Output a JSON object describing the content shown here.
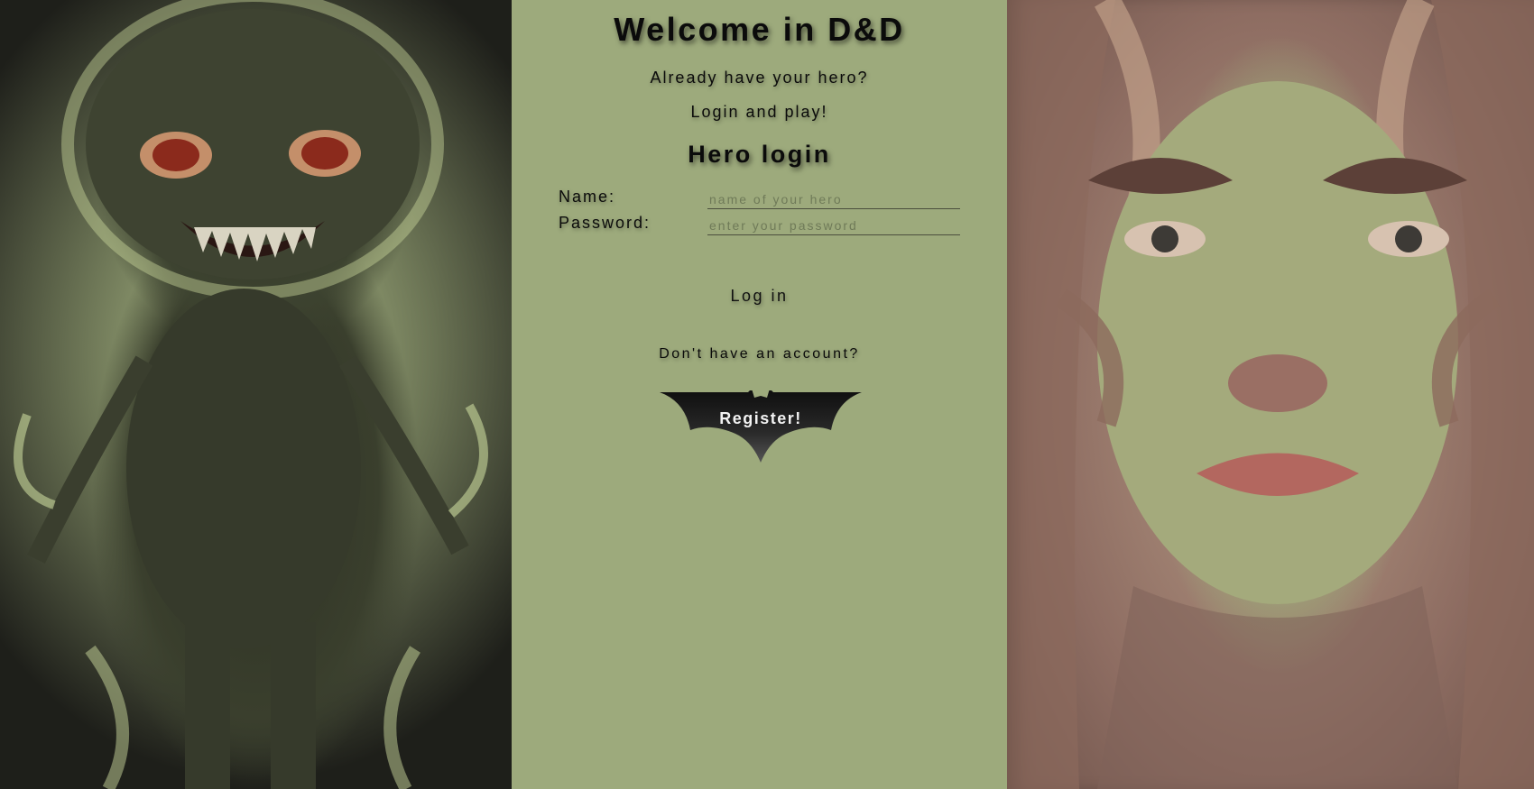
{
  "page": {
    "title": "Welcome in D&D",
    "subtitle_1": "Already have your hero?",
    "subtitle_2": "Login and play!"
  },
  "login_form": {
    "heading": "Hero login",
    "name_label": "Name:",
    "name_placeholder": "name of your hero",
    "name_value": "",
    "password_label": "Password:",
    "password_placeholder": "enter your password",
    "password_value": "",
    "submit_label": "Log in"
  },
  "register": {
    "prompt": "Don't have an account?",
    "button_label": "Register!"
  },
  "icons": {
    "register_button_shape": "bat-logo-icon",
    "left_art": "monster-illustration",
    "right_art": "woman-portrait-illustration"
  },
  "colors": {
    "background": "#9daa7c",
    "text": "#0b0b0b",
    "register_button": "#1a1a1a"
  }
}
